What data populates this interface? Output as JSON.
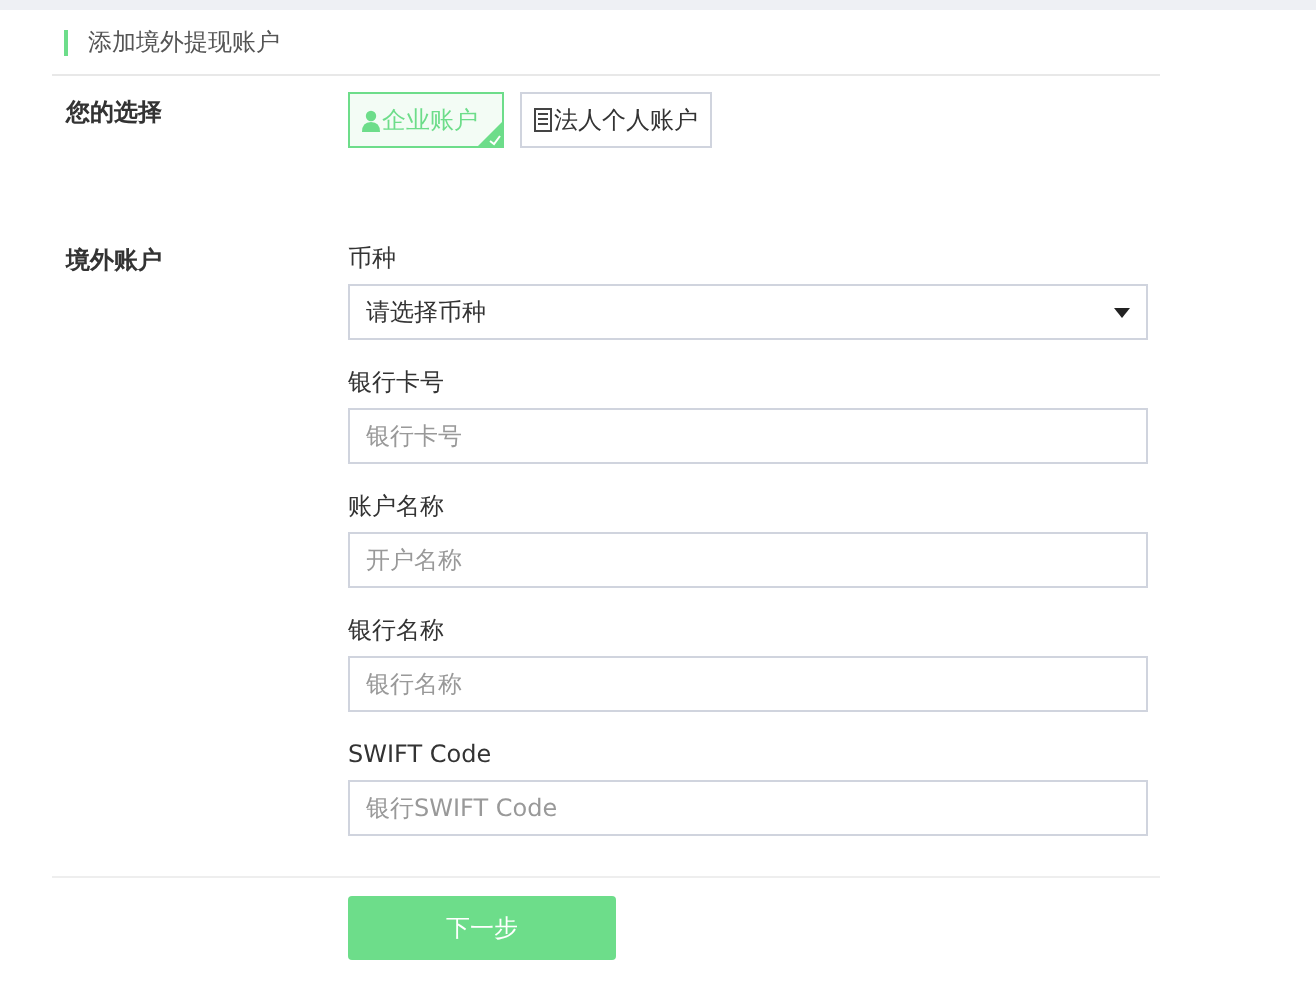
{
  "title": "添加境外提现账户",
  "account_type": {
    "label": "您的选择",
    "options": [
      {
        "label": "企业账户",
        "kind": "person",
        "selected": true
      },
      {
        "label": "法人个人账户",
        "kind": "card",
        "selected": false
      }
    ]
  },
  "overseas_account": {
    "label": "境外账户",
    "fields": [
      {
        "label": "币种",
        "kind": "select",
        "value": "请选择币种"
      },
      {
        "label": "银行卡号",
        "kind": "input",
        "placeholder": "银行卡号"
      },
      {
        "label": "账户名称",
        "kind": "input",
        "placeholder": "开户名称"
      },
      {
        "label": "银行名称",
        "kind": "input",
        "placeholder": "银行名称"
      },
      {
        "label": "SWIFT Code",
        "kind": "input",
        "placeholder": "银行SWIFT Code"
      }
    ]
  },
  "next_button": "下一步"
}
